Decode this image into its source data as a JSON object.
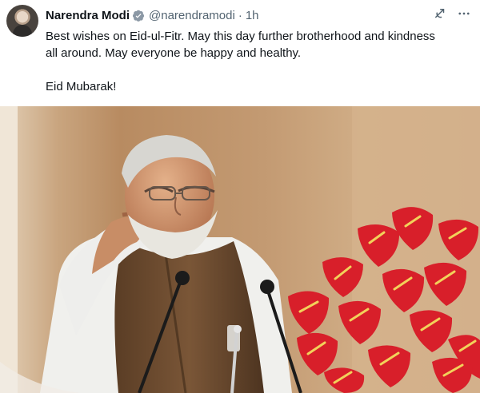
{
  "tweet": {
    "author": {
      "name": "Narendra Modi",
      "handle": "@narendramodi",
      "avatar_icon": "profile-avatar",
      "verified_icon": "verified-badge-icon"
    },
    "meta": {
      "separator": "·",
      "time": "1h"
    },
    "body": {
      "line1": "Best wishes on Eid-ul-Fitr. May this day further brotherhood and kindness",
      "line2": "all around. May everyone be happy and healthy.",
      "line3": "Eid Mubarak!"
    },
    "actions": [
      {
        "icon": "grok-icon",
        "label": "Grok"
      },
      {
        "icon": "more-icon",
        "label": "More"
      }
    ],
    "media": {
      "type": "photo",
      "subject": "speaker at podium with microphones and red anthurium flowers"
    },
    "colors": {
      "text": "#0f1419",
      "secondary": "#536471",
      "verified": "#1d9bf0",
      "flower": "#d81f2a"
    }
  }
}
